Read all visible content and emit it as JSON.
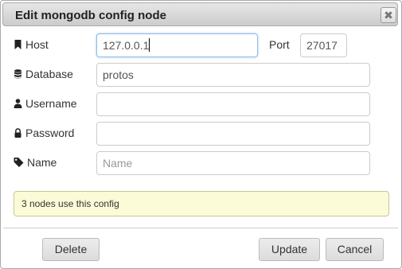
{
  "dialog": {
    "title": "Edit mongodb config node",
    "close_glyph": "✖"
  },
  "form": {
    "host": {
      "label": "Host",
      "icon": "bookmark-icon",
      "value": "127.0.0.1"
    },
    "port": {
      "label": "Port",
      "value": "27017"
    },
    "database": {
      "label": "Database",
      "icon": "database-icon",
      "value": "protos"
    },
    "username": {
      "label": "Username",
      "icon": "user-icon",
      "value": ""
    },
    "password": {
      "label": "Password",
      "icon": "lock-icon",
      "value": ""
    },
    "name": {
      "label": "Name",
      "icon": "tag-icon",
      "value": "",
      "placeholder": "Name"
    }
  },
  "info": {
    "text": "3 nodes use this config"
  },
  "buttons": {
    "delete": "Delete",
    "update": "Update",
    "cancel": "Cancel"
  },
  "colors": {
    "focus_border": "#8fbde6",
    "info_background": "#fbfbd8",
    "info_border": "#c8c890"
  }
}
